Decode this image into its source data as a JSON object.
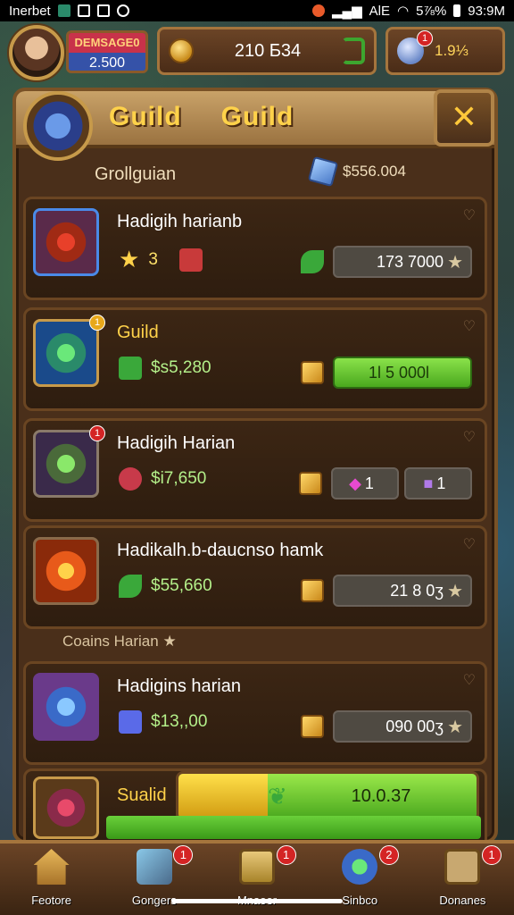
{
  "status_bar": {
    "carrier": "Inerbet",
    "battery": "5⅞%",
    "signal_label": "AlE",
    "time": "93:9M"
  },
  "player": {
    "name": "DEMSAGE0",
    "level": "2.500"
  },
  "currency": {
    "gold": "210 Ƃ34",
    "gems": "1.9⅓",
    "gems_badge": "1"
  },
  "panel": {
    "title_left": "Guild",
    "title_right": "Guild",
    "close_symbol": "✕",
    "subheader": "Grollguian",
    "treasury_value": "$556.004"
  },
  "rows": [
    {
      "title": "Hadigih harianb",
      "stat": "3",
      "value": "173 7000",
      "action_style": "grey"
    },
    {
      "title": "Guild",
      "stat": "$ѕ5,280",
      "value": "1Ɩ 5 000Ɩ",
      "action_style": "green",
      "icon_badge": "1"
    },
    {
      "title": "Hadigih Harian",
      "stat": "$i7,650",
      "value_left": "1",
      "value_right": "1",
      "action_style": "split",
      "icon_badge": "1"
    },
    {
      "title": "Hadikalh.b-daucnso hamk",
      "stat": "$55,660",
      "value": "21 8 0ʒ",
      "action_style": "grey"
    }
  ],
  "section_label": "Coains Harian ★",
  "row5": {
    "title": "Hadigins harian",
    "stat": "$13,,00",
    "value": "090 00ʒ"
  },
  "progress_row": {
    "title": "Sualid",
    "value": "10.0.37",
    "percent": 30
  },
  "bottom_nav": [
    {
      "label": "Feotore",
      "badge": ""
    },
    {
      "label": "Gongers",
      "badge": "1"
    },
    {
      "label": "Mnaoer",
      "badge": "1"
    },
    {
      "label": "Sinbco",
      "badge": "2"
    },
    {
      "label": "Donanes",
      "badge": "1"
    }
  ],
  "colors": {
    "accent_gold": "#ffd24a",
    "panel_brown": "#4a2f1a",
    "progress_green": "#4aa81e",
    "badge_red": "#d42424"
  }
}
